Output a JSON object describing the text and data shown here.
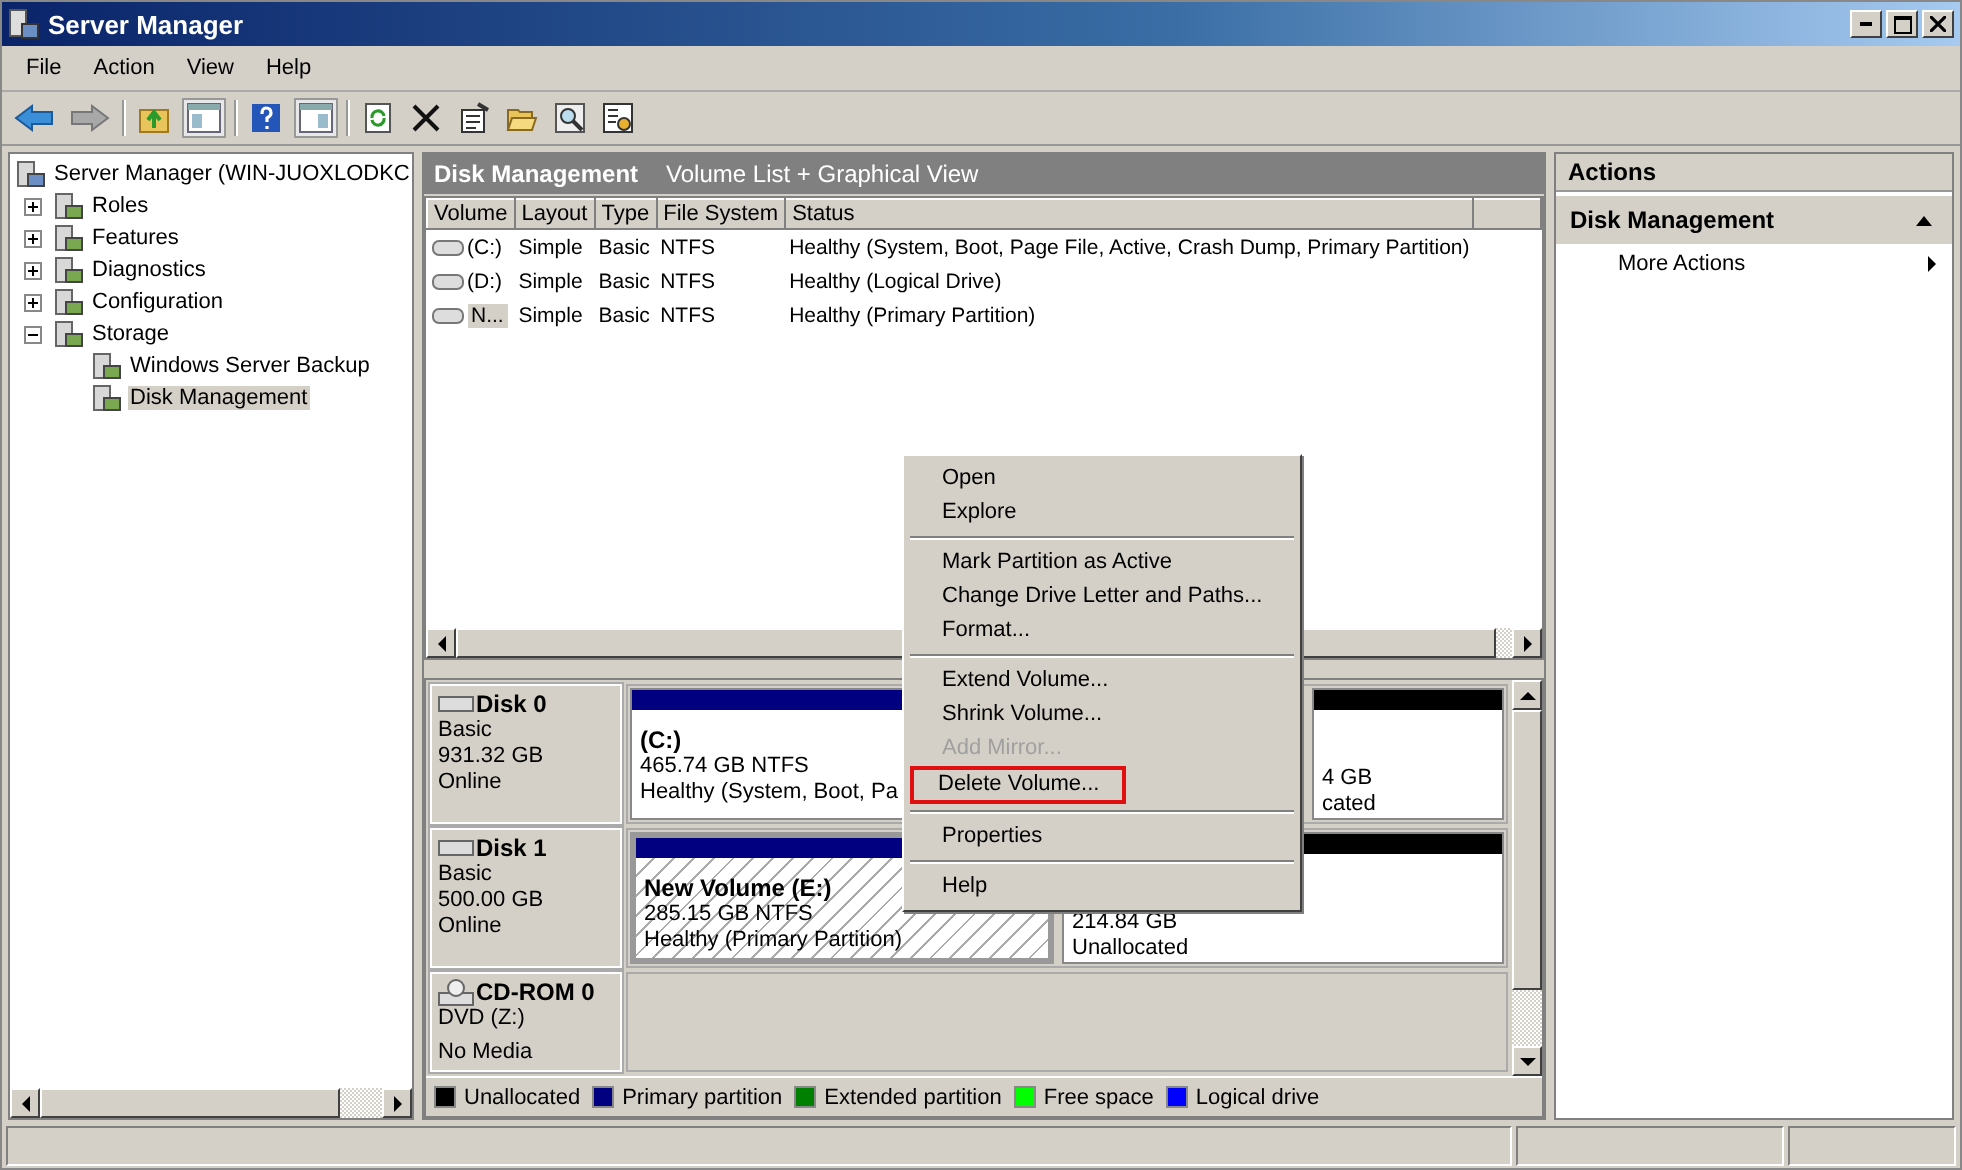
{
  "window": {
    "title": "Server Manager"
  },
  "menu_bar": [
    "File",
    "Action",
    "View",
    "Help"
  ],
  "tree": {
    "label": "Server Manager (WIN-JUOXLODKC",
    "selected": false,
    "children": [
      {
        "label": "Roles",
        "expanded": false,
        "selected": false
      },
      {
        "label": "Features",
        "expanded": false,
        "selected": false
      },
      {
        "label": "Diagnostics",
        "expanded": false,
        "selected": false
      },
      {
        "label": "Configuration",
        "expanded": false,
        "selected": false
      },
      {
        "label": "Storage",
        "expanded": true,
        "selected": false,
        "children": [
          {
            "label": "Windows Server Backup",
            "selected": false
          },
          {
            "label": "Disk Management",
            "selected": true
          }
        ]
      }
    ]
  },
  "center": {
    "title": "Disk Management",
    "subtitle": "Volume List + Graphical View",
    "columns": [
      "Volume",
      "Layout",
      "Type",
      "File System",
      "Status"
    ],
    "rows": [
      {
        "cells": [
          "(C:)",
          "Simple",
          "Basic",
          "NTFS",
          "Healthy (System, Boot, Page File, Active, Crash Dump, Primary Partition)"
        ],
        "selected": false
      },
      {
        "cells": [
          "(D:)",
          "Simple",
          "Basic",
          "NTFS",
          "Healthy (Logical Drive)"
        ],
        "selected": false
      },
      {
        "cells": [
          "N...",
          "Simple",
          "Basic",
          "NTFS",
          "Healthy (Primary Partition)"
        ],
        "selected": true
      }
    ],
    "disks": [
      {
        "kind": "disk",
        "name": "Disk 0",
        "lines": [
          "Basic",
          "931.32 GB",
          "Online"
        ],
        "partitions": [
          {
            "title": "(C:)",
            "lines": [
              "465.74 GB NTFS",
              "Healthy (System, Boot, Pa"
            ],
            "color": "#000080",
            "selected": false
          },
          {
            "lines": [
              "4 GB",
              "cated"
            ],
            "color": "#000000",
            "selected": false
          }
        ]
      },
      {
        "kind": "disk",
        "name": "Disk 1",
        "lines": [
          "Basic",
          "500.00 GB",
          "Online"
        ],
        "partitions": [
          {
            "title": "New Volume  (E:)",
            "lines": [
              "285.15 GB NTFS",
              "Healthy (Primary Partition)"
            ],
            "color": "#000080",
            "selected": true
          },
          {
            "lines": [
              "214.84 GB",
              "Unallocated"
            ],
            "color": "#000000",
            "selected": false
          }
        ]
      },
      {
        "kind": "cdrom",
        "name": "CD-ROM 0",
        "lines": [
          "DVD (Z:)",
          "No Media"
        ]
      }
    ],
    "legend": [
      {
        "label": "Unallocated",
        "color": "#000000"
      },
      {
        "label": "Primary partition",
        "color": "#000080"
      },
      {
        "label": "Extended partition",
        "color": "#008000"
      },
      {
        "label": "Free space",
        "color": "#00ff00"
      },
      {
        "label": "Logical drive",
        "color": "#0000ff"
      }
    ]
  },
  "actions": {
    "title": "Actions",
    "section": "Disk Management",
    "expanded": true,
    "items": [
      "More Actions"
    ]
  },
  "context_menu": [
    {
      "kind": "item",
      "label": "Open",
      "disabled": false,
      "highlighted": false
    },
    {
      "kind": "item",
      "label": "Explore",
      "disabled": false,
      "highlighted": false
    },
    {
      "kind": "separator"
    },
    {
      "kind": "item",
      "label": "Mark Partition as Active",
      "disabled": false,
      "highlighted": false
    },
    {
      "kind": "item",
      "label": "Change Drive Letter and Paths...",
      "disabled": false,
      "highlighted": false
    },
    {
      "kind": "item",
      "label": "Format...",
      "disabled": false,
      "highlighted": false
    },
    {
      "kind": "separator"
    },
    {
      "kind": "item",
      "label": "Extend Volume...",
      "disabled": false,
      "highlighted": false
    },
    {
      "kind": "item",
      "label": "Shrink Volume...",
      "disabled": false,
      "highlighted": false
    },
    {
      "kind": "item",
      "label": "Add Mirror...",
      "disabled": true,
      "highlighted": false
    },
    {
      "kind": "item",
      "label": "Delete Volume...",
      "disabled": false,
      "highlighted": true
    },
    {
      "kind": "separator"
    },
    {
      "kind": "item",
      "label": "Properties",
      "disabled": false,
      "highlighted": false
    },
    {
      "kind": "separator"
    },
    {
      "kind": "item",
      "label": "Help",
      "disabled": false,
      "highlighted": false
    }
  ]
}
